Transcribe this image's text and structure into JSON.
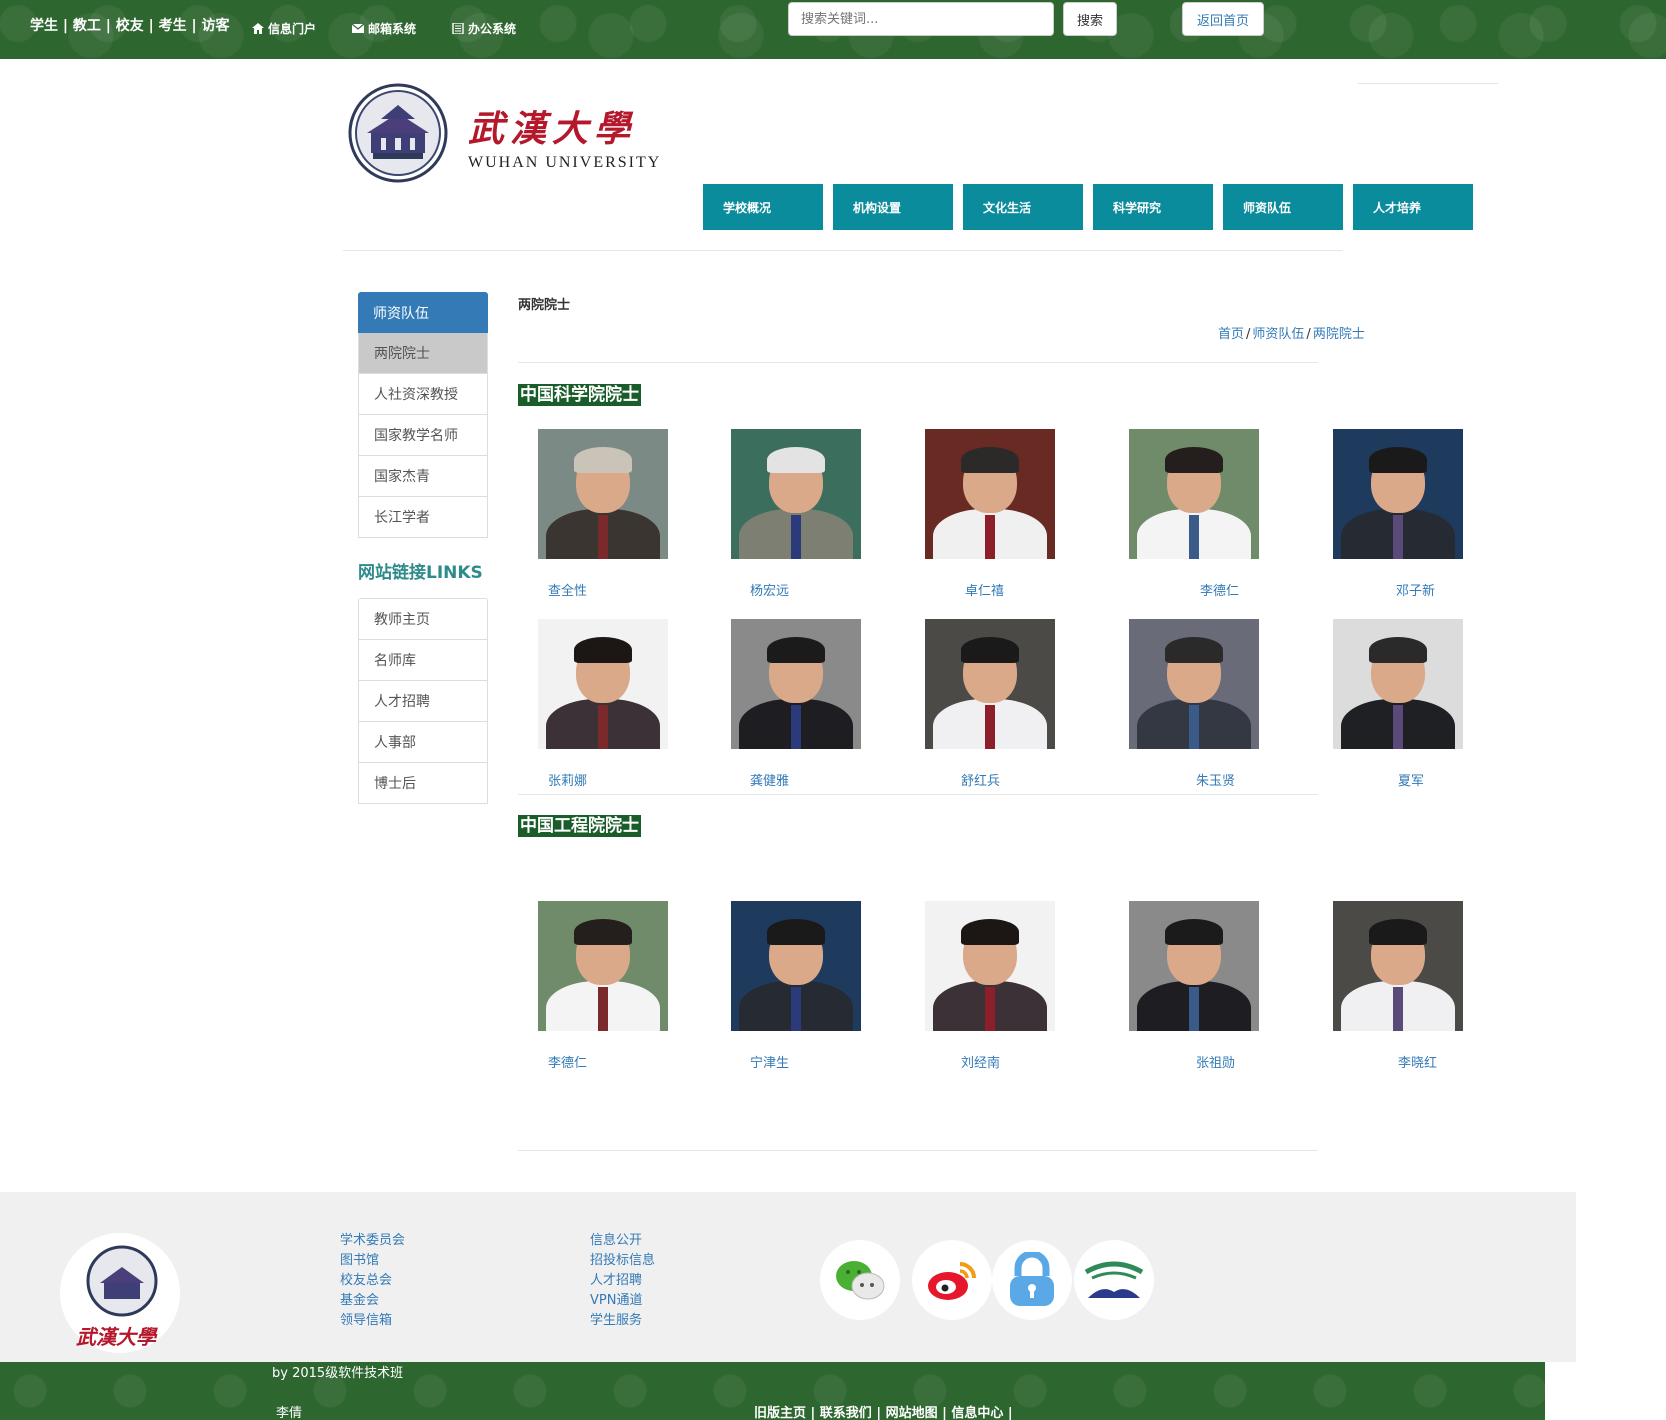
{
  "topbar": {
    "roles": "学生 | 教工 | 校友 | 考生 | 访客",
    "portal_label": "信息门户",
    "mail_label": "邮箱系统",
    "office_label": "办公系统",
    "search_placeholder": "搜索关键词...",
    "search_button": "搜索",
    "home_button": "返回首页",
    "colors": {
      "bar": "#2e6630"
    }
  },
  "header": {
    "logo_cn": "武漢大學",
    "logo_en": "WUHAN UNIVERSITY",
    "nav": [
      "学校概况",
      "机构设置",
      "文化生活",
      "科学研究",
      "师资队伍",
      "人才培养"
    ],
    "nav_color": "#0b8c9d"
  },
  "sidebar": {
    "heading": "师资队伍",
    "items": [
      "两院院士",
      "人社资深教授",
      "国家教学名师",
      "国家杰青",
      "长江学者"
    ],
    "active_index": 0,
    "links_title": "网站链接LINKS",
    "links": [
      "教师主页",
      "名师库",
      "人才招聘",
      "人事部",
      "博士后"
    ]
  },
  "content": {
    "title": "两院院士",
    "breadcrumb": [
      "首页",
      "师资队伍",
      "两院院士"
    ],
    "sections": [
      {
        "title": "中国科学院院士",
        "people": [
          "查全性",
          "杨宏远",
          "卓仁禧",
          "李德仁",
          "邓子新",
          "张莉娜",
          "龚健雅",
          "舒红兵",
          "朱玉贤",
          "夏军"
        ]
      },
      {
        "title": "中国工程院院士",
        "people": [
          "李德仁",
          "宁津生",
          "刘经南",
          "张祖勋",
          "李晓红"
        ]
      }
    ]
  },
  "footer": {
    "col1": [
      "学术委员会",
      "图书馆",
      "校友总会",
      "基金会",
      "领导信箱"
    ],
    "col2": [
      "信息公开",
      "招投标信息",
      "人才招聘",
      "VPN通道",
      "学生服务"
    ],
    "social_icons": [
      "wechat-icon",
      "weibo-icon",
      "lock-icon",
      "library-icon"
    ],
    "seal_text": "武漢大學",
    "by": "by 2015级软件技术班",
    "author": "李倩",
    "bottom_links": "旧版主页 | 联系我们 | 网站地图 | 信息中心 |"
  }
}
